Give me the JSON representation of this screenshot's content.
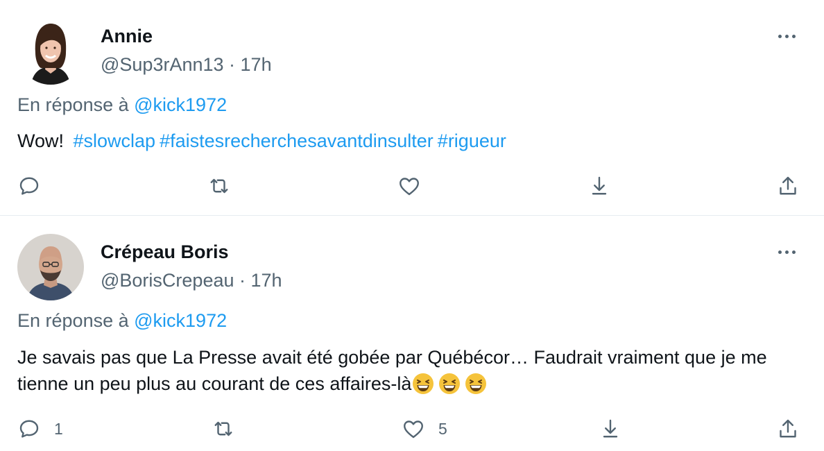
{
  "tweets": [
    {
      "name": "Annie",
      "handle": "@Sup3rAnn13",
      "separator": " · ",
      "time": "17h",
      "reply_prefix": "En réponse à ",
      "reply_to": "@kick1972",
      "text": "Wow! ",
      "hashtags": [
        "#slowclap",
        "#faistesrecherchesavantdinsulter",
        "#rigueur"
      ],
      "reply_count": "",
      "retweet_count": "",
      "like_count": ""
    },
    {
      "name": "Crépeau Boris",
      "handle": "@BorisCrepeau",
      "separator": " · ",
      "time": "17h",
      "reply_prefix": "En réponse à ",
      "reply_to": "@kick1972",
      "text": "Je savais pas que La Presse avait été gobée par Québécor… Faudrait vraiment que je me tienne un peu plus au courant de ces affaires-là",
      "emojis": [
        "grinning-squinting-face",
        "grinning-squinting-face",
        "grinning-squinting-face"
      ],
      "reply_count": "1",
      "retweet_count": "",
      "like_count": "5"
    }
  ],
  "colors": {
    "link": "#1d9bf0",
    "secondary_text": "#536471",
    "primary_text": "#0f1419",
    "divider": "#e6ecf0"
  },
  "icons": [
    "reply-icon",
    "retweet-icon",
    "like-icon",
    "download-icon",
    "share-icon",
    "more-icon"
  ]
}
